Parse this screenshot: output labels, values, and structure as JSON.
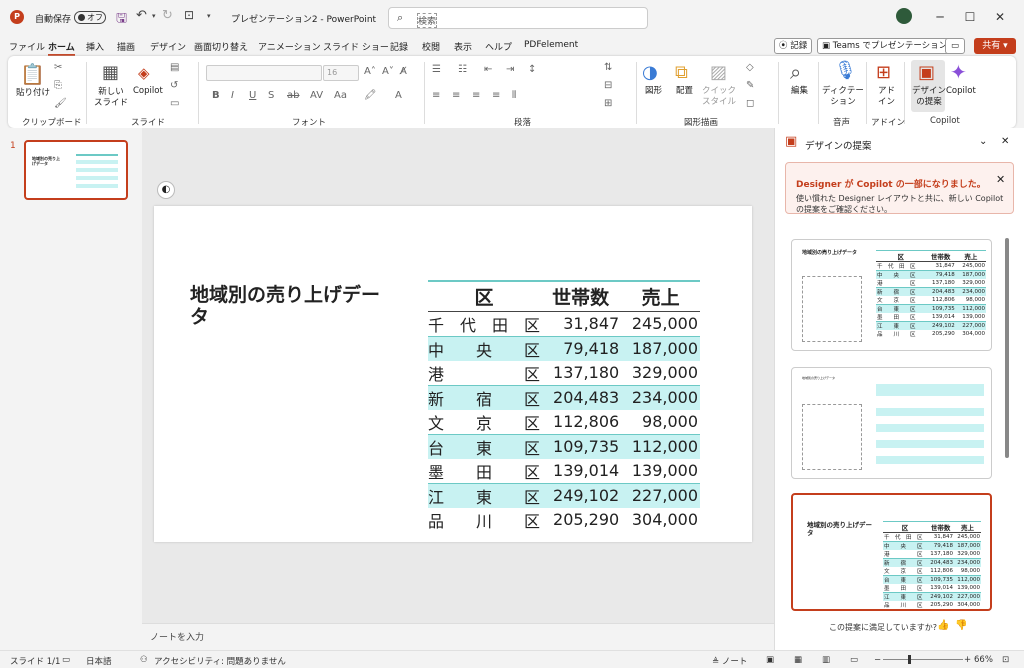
{
  "titlebar": {
    "autosave_label": "自動保存",
    "autosave_state": "オフ",
    "doc_title": "プレゼンテーション2 - PowerPoint",
    "search_placeholder": "検索"
  },
  "tabs": [
    "ファイル",
    "ホーム",
    "挿入",
    "描画",
    "デザイン",
    "画面切り替え",
    "アニメーション",
    "スライド ショー",
    "記録",
    "校閲",
    "表示",
    "ヘルプ",
    "PDFelement"
  ],
  "active_tab": "ホーム",
  "top_right": {
    "record": "記録",
    "teams": "Teams でプレゼンテーション",
    "share": "共有"
  },
  "ribbon": {
    "paste": "貼り付け",
    "new_slide": "新しい\nスライド",
    "copilot": "Copilot",
    "font_name": "",
    "font_size": "16",
    "shapes": "図形",
    "arrange": "配置",
    "quick_style": "クイック\nスタイル",
    "editing": "編集",
    "dictate": "ディクテー\nション",
    "addins": "アド\nイン",
    "designer": "デザイン\nの提案",
    "copilot2": "Copilot",
    "groups": [
      "クリップボード",
      "スライド",
      "フォント",
      "段落",
      "図形描画",
      "音声",
      "アドイン",
      "Copilot"
    ]
  },
  "thumb_number": "1",
  "slide": {
    "title": "地域別の売り上げデータ",
    "headers": [
      "区",
      "世帯数",
      "売上"
    ],
    "rows": [
      [
        "千　代　田　区",
        "31,847",
        "245,000"
      ],
      [
        "中　　央　　区",
        "79,418",
        "187,000"
      ],
      [
        "港　　　　　区",
        "137,180",
        "329,000"
      ],
      [
        "新　　宿　　区",
        "204,483",
        "234,000"
      ],
      [
        "文　　京　　区",
        "112,806",
        "98,000"
      ],
      [
        "台　　東　　区",
        "109,735",
        "112,000"
      ],
      [
        "墨　　田　　区",
        "139,014",
        "139,000"
      ],
      [
        "江　　東　　区",
        "249,102",
        "227,000"
      ],
      [
        "品　　川　　区",
        "205,290",
        "304,000"
      ]
    ]
  },
  "notes_placeholder": "ノートを入力",
  "pane": {
    "title": "デザインの提案",
    "banner_heading": "Designer が Copilot の一部になりました。",
    "banner_body": "使い慣れた Designer レイアウトと共に、新しい Copilot の提案をご確認ください。",
    "feedback": "この提案に満足していますか?"
  },
  "status": {
    "slide": "スライド 1/1",
    "language": "日本語",
    "accessibility": "アクセシビリティ: 問題ありません",
    "notes": "ノート",
    "zoom": "66%"
  },
  "colors": {
    "accent": "#c43e1c",
    "teal": "#6cc9c5",
    "band": "#c8f2f2"
  }
}
